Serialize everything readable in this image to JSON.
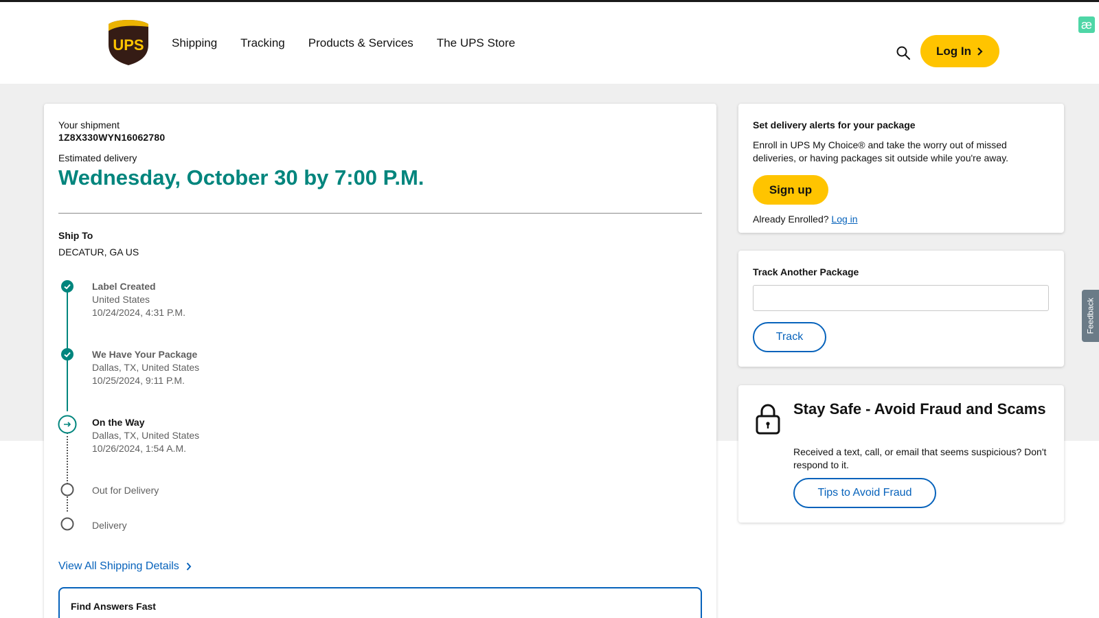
{
  "header": {
    "nav": [
      "Shipping",
      "Tracking",
      "Products & Services",
      "The UPS Store"
    ],
    "login_label": "Log In",
    "logo_text": "UPS",
    "badge_text": "æ"
  },
  "shipment": {
    "your_shipment_label": "Your shipment",
    "tracking_number": "1Z8X330WYN16062780",
    "estimated_label": "Estimated delivery",
    "estimated_date": "Wednesday, October 30 by 7:00 P.M.",
    "ship_to_label": "Ship To",
    "ship_to_value": "DECATUR, GA US"
  },
  "timeline": [
    {
      "title": "Label Created",
      "location": "United States",
      "datetime": "10/24/2024, 4:31 P.M.",
      "status": "done"
    },
    {
      "title": "We Have Your Package",
      "location": "Dallas, TX, United States",
      "datetime": "10/25/2024, 9:11 P.M.",
      "status": "done"
    },
    {
      "title": "On the Way",
      "location": "Dallas, TX, United States",
      "datetime": "10/26/2024, 1:54 A.M.",
      "status": "current"
    },
    {
      "title": "Out for Delivery",
      "status": "pending"
    },
    {
      "title": "Delivery",
      "status": "pending"
    }
  ],
  "view_all_label": "View All Shipping Details",
  "find_answers_label": "Find Answers Fast",
  "alerts": {
    "title": "Set delivery alerts for your package",
    "body": "Enroll in UPS My Choice® and take the worry out of missed deliveries, or having packages sit outside while you're away.",
    "signup_label": "Sign up",
    "enrolled_text": "Already Enrolled?",
    "login_link": "Log in"
  },
  "track_another": {
    "title": "Track Another Package",
    "input_value": "",
    "button_label": "Track"
  },
  "fraud": {
    "title": "Stay Safe - Avoid Fraud and Scams",
    "body": "Received a text, call, or email that seems suspicious? Don't respond to it.",
    "button_label": "Tips to Avoid Fraud"
  },
  "feedback_label": "Feedback",
  "colors": {
    "ups_brown": "#351c15",
    "ups_gold": "#ffc400",
    "teal": "#00857d",
    "link_blue": "#0662bb"
  }
}
